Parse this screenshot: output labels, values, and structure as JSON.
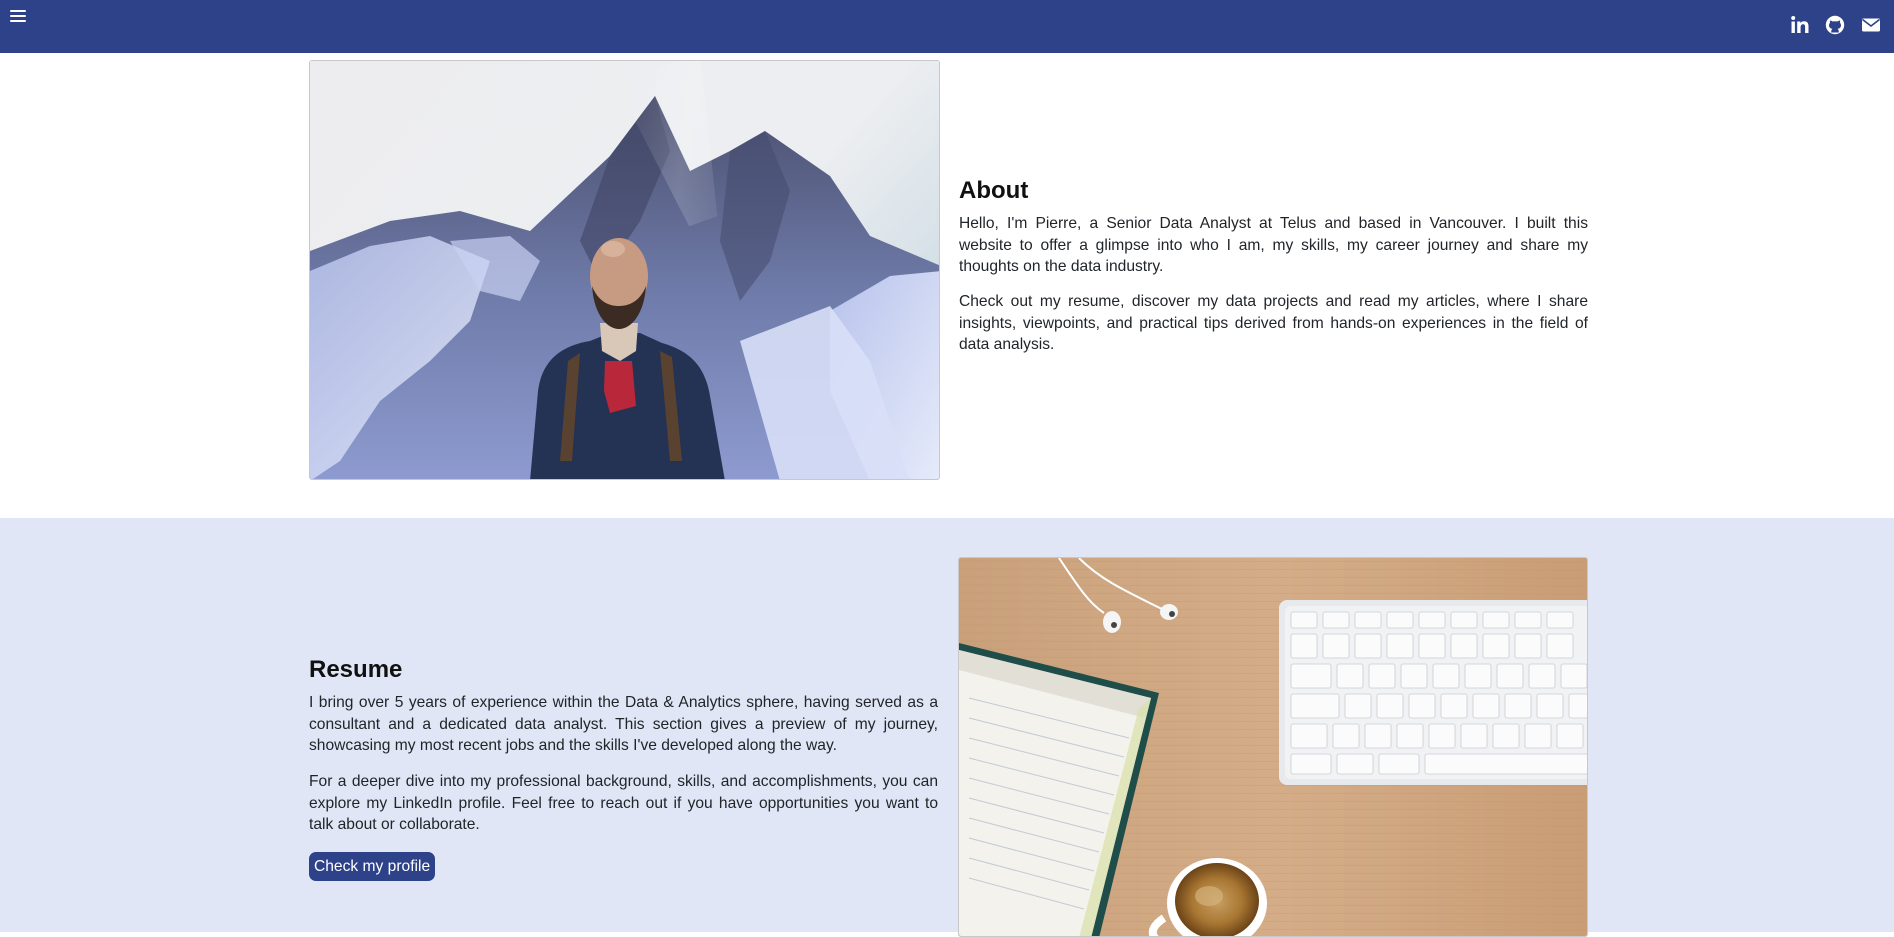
{
  "navbar": {
    "menu_icon": "hamburger-menu-icon",
    "social_links": [
      {
        "name": "LinkedIn",
        "icon": "linkedin-icon"
      },
      {
        "name": "GitHub",
        "icon": "github-icon"
      },
      {
        "name": "Email",
        "icon": "envelope-icon"
      }
    ]
  },
  "about": {
    "title": "About",
    "paragraphs": [
      "Hello, I'm Pierre, a Senior Data Analyst at Telus and based in Vancouver. I built this website to offer a glimpse into who I am, my skills, my career journey and share my thoughts on the data industry.",
      "Check out my resume, discover my data projects and read my articles, where I share insights, viewpoints, and practical tips derived from hands-on experiences in the field of data analysis."
    ]
  },
  "resume": {
    "title": "Resume",
    "paragraphs": [
      "I bring over 5 years of experience within the Data & Analytics sphere, having served as a consultant and a dedicated data analyst. This section gives a preview of my journey, showcasing my most recent jobs and the skills I've developed along the way.",
      "For a deeper dive into my professional background, skills, and accomplishments, you can explore my LinkedIn profile. Feel free to reach out if you have opportunities you want to talk about or collaborate."
    ],
    "button_label": "Check my profile"
  },
  "colors": {
    "navbar": "#2d4289",
    "resume_background": "#e1e6f6",
    "button": "#2d4289"
  }
}
